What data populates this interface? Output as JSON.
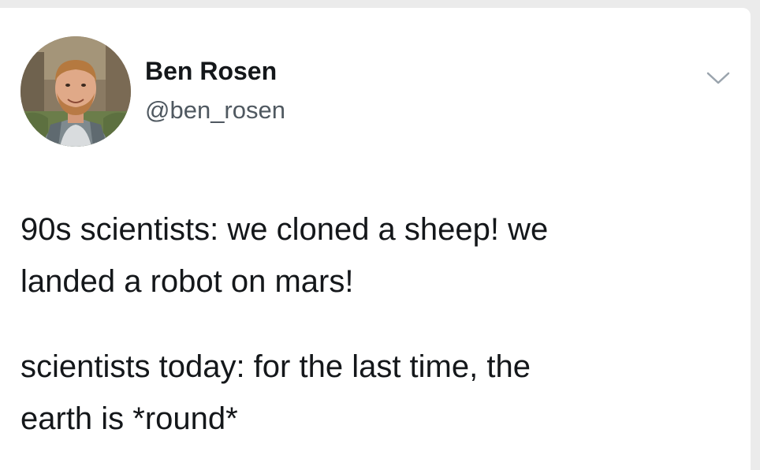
{
  "tweet": {
    "author": {
      "display_name": "Ben Rosen",
      "handle": "@ben_rosen"
    },
    "menu_icon": "chevron-down-icon",
    "paragraphs": [
      {
        "lines": [
          "90s scientists: we cloned a sheep! we",
          "landed a robot on mars!"
        ]
      },
      {
        "lines": [
          "scientists today: for the last time, the",
          "earth is *round*"
        ]
      }
    ]
  },
  "colors": {
    "background": "#ebebeb",
    "card": "#ffffff",
    "text": "#14171a",
    "secondary_text": "#4f5860",
    "chevron": "#9aa4ad"
  }
}
